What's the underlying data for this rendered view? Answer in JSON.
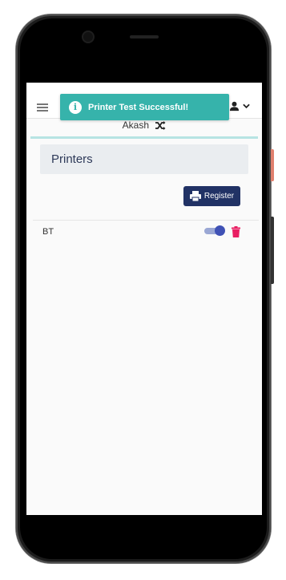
{
  "toast": {
    "message": "Printer Test Successful!",
    "icon": "info-icon"
  },
  "header": {
    "user_name": "Akash"
  },
  "page": {
    "title": "Printers",
    "register_label": "Register"
  },
  "printers": [
    {
      "name": "BT",
      "enabled": true
    }
  ],
  "colors": {
    "accent": "#213265",
    "toast": "#36b3ab",
    "toggle": "#3f51b5",
    "delete": "#e91e63"
  }
}
